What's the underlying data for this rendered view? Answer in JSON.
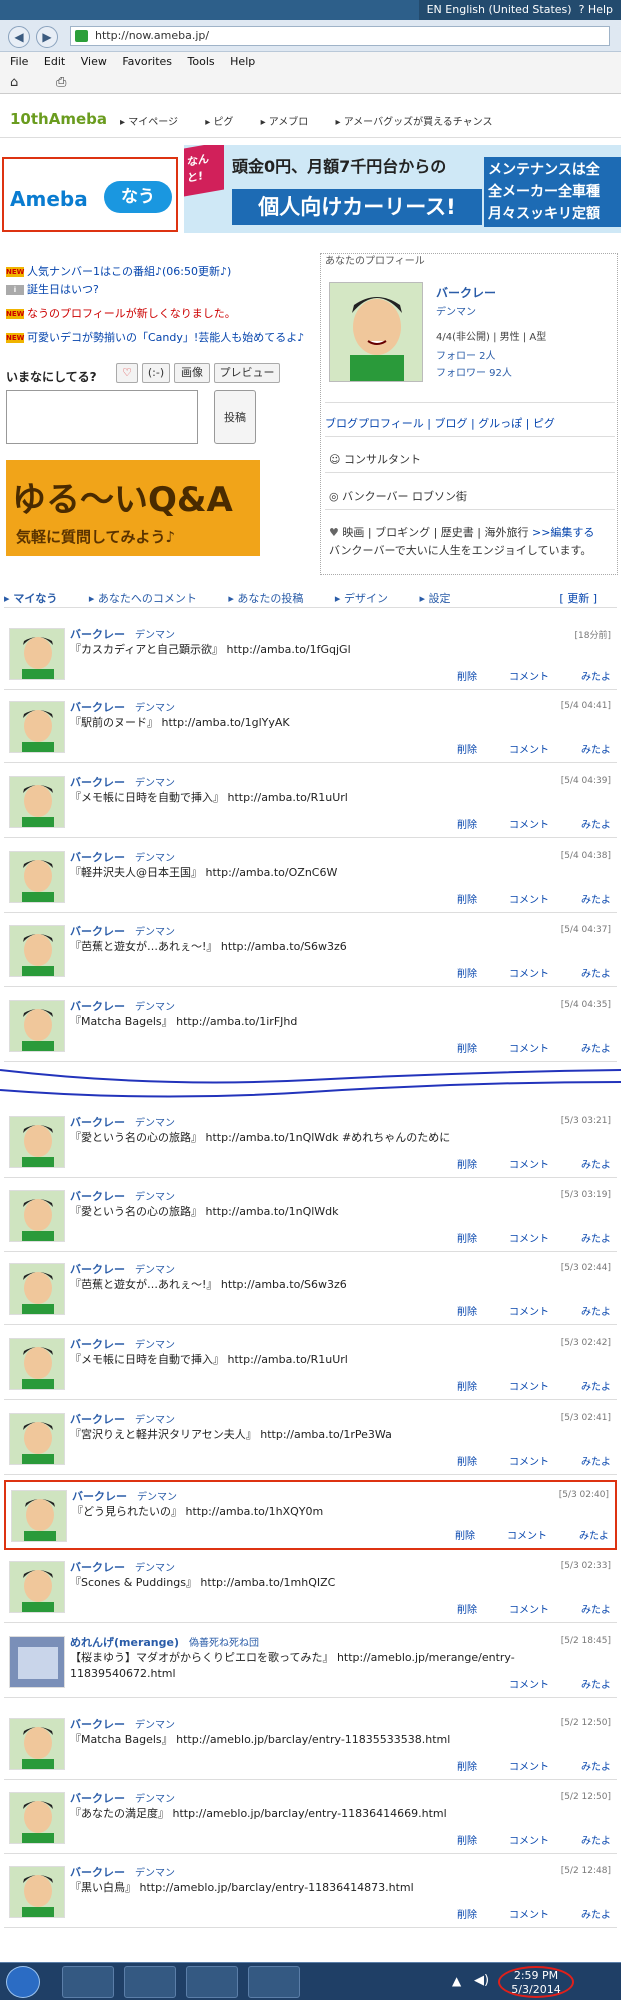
{
  "browser": {
    "language": "EN English (United States)",
    "help": "Help",
    "url": "http://now.ameba.jp/",
    "menu": [
      "File",
      "Edit",
      "View",
      "Favorites",
      "Tools",
      "Help"
    ]
  },
  "header": {
    "logo": "10thAmeba",
    "nav": [
      "マイページ",
      "ピグ",
      "アメブロ",
      "アメーバグッズが買えるチャンス"
    ]
  },
  "brand": {
    "ameba": "Ameba",
    "now": "なう"
  },
  "ad": {
    "tag": "なんと!",
    "line1": "頭金0円、月額7千円台からの",
    "line2": "個人向けカーリース!",
    "side": [
      "メンテナンスは全",
      "全メーカー全車種",
      "月々スッキリ定額"
    ]
  },
  "notices": [
    "人気ナンバー1はこの番組♪(06:50更新♪)",
    "誕生日はいつ?",
    "なうのプロフィールが新しくなりました。",
    "可愛いデコが勢揃いの「Candy」!芸能人も始めてるよ♪"
  ],
  "compose": {
    "label": "いまなにしてる?",
    "buttons": [
      "♡",
      "(:-)",
      "画像",
      "プレビュー"
    ],
    "post": "投稿"
  },
  "qa": {
    "title": "ゆる〜いQ&A",
    "sub": "気軽に質問してみよう♪"
  },
  "profile": {
    "header": "あなたのプロフィール",
    "name": "バークレー",
    "sub": "デンマン",
    "info": "4/4(非公開) | 男性 | A型",
    "follow": "フォロー 2人",
    "followers": "フォロワー 92人",
    "links": "ブログプロフィール | ブログ | グルっぽ | ピグ",
    "job": "コンサルタント",
    "location": "バンクーバー ロブソン街",
    "hobbies": "映画 | ブロギング | 歴史書 | 海外旅行",
    "edit": ">>編集する",
    "bio": "バンクーバーで大いに人生をエンジョイしています。"
  },
  "tabs": [
    "マイなう",
    "あなたへのコメント",
    "あなたの投稿",
    "デザイン",
    "設定"
  ],
  "refresh": "[ 更新 ]",
  "actions": {
    "delete": "削除",
    "comment": "コメント",
    "seen": "みたよ"
  },
  "feed": [
    {
      "name": "バークレー",
      "sub": "デンマン",
      "time": "[18分前]",
      "text": "『カスカディアと自己顕示欲』 http://amba.to/1fGqjGl"
    },
    {
      "name": "バークレー",
      "sub": "デンマン",
      "time": "[5/4 04:41]",
      "text": "『駅前のヌード』 http://amba.to/1glYyAK"
    },
    {
      "name": "バークレー",
      "sub": "デンマン",
      "time": "[5/4 04:39]",
      "text": "『メモ帳に日時を自動で挿入』 http://amba.to/R1uUrl"
    },
    {
      "name": "バークレー",
      "sub": "デンマン",
      "time": "[5/4 04:38]",
      "text": "『軽井沢夫人@日本王国』 http://amba.to/OZnC6W"
    },
    {
      "name": "バークレー",
      "sub": "デンマン",
      "time": "[5/4 04:37]",
      "text": "『芭蕉と遊女が…あれぇ〜!』 http://amba.to/S6w3z6"
    },
    {
      "name": "バークレー",
      "sub": "デンマン",
      "time": "[5/4 04:35]",
      "text": "『Matcha Bagels』 http://amba.to/1irFJhd"
    },
    {
      "name": "バークレー",
      "sub": "デンマン",
      "time": "[5/3 03:21]",
      "text": "『愛という名の心の旅路』 http://amba.to/1nQlWdk #めれちゃんのために"
    },
    {
      "name": "バークレー",
      "sub": "デンマン",
      "time": "[5/3 03:19]",
      "text": "『愛という名の心の旅路』 http://amba.to/1nQlWdk"
    },
    {
      "name": "バークレー",
      "sub": "デンマン",
      "time": "[5/3 02:44]",
      "text": "『芭蕉と遊女が…あれぇ〜!』 http://amba.to/S6w3z6"
    },
    {
      "name": "バークレー",
      "sub": "デンマン",
      "time": "[5/3 02:42]",
      "text": "『メモ帳に日時を自動で挿入』 http://amba.to/R1uUrl"
    },
    {
      "name": "バークレー",
      "sub": "デンマン",
      "time": "[5/3 02:41]",
      "text": "『宮沢りえと軽井沢タリアセン夫人』 http://amba.to/1rPe3Wa"
    },
    {
      "name": "バークレー",
      "sub": "デンマン",
      "time": "[5/3 02:40]",
      "text": "『どう見られたいの』 http://amba.to/1hXQY0m"
    },
    {
      "name": "バークレー",
      "sub": "デンマン",
      "time": "[5/3 02:33]",
      "text": "『Scones & Puddings』 http://amba.to/1mhQIZC"
    },
    {
      "name": "めれんげ(merange)",
      "sub": "偽善死ね死ね団",
      "time": "[5/2 18:45]",
      "text": "【桜まゆう】マダオがからくりピエロを歌ってみた』 http://ameblo.jp/merange/entry-11839540672.html"
    },
    {
      "name": "バークレー",
      "sub": "デンマン",
      "time": "[5/2 12:50]",
      "text": "『Matcha Bagels』 http://ameblo.jp/barclay/entry-11835533538.html"
    },
    {
      "name": "バークレー",
      "sub": "デンマン",
      "time": "[5/2 12:50]",
      "text": "『あなたの満足度』 http://ameblo.jp/barclay/entry-11836414669.html"
    },
    {
      "name": "バークレー",
      "sub": "デンマン",
      "time": "[5/2 12:48]",
      "text": "『黒い白鳥』 http://ameblo.jp/barclay/entry-11836414873.html"
    }
  ],
  "clock": {
    "time": "2:59 PM",
    "date": "5/3/2014"
  },
  "colors": {
    "link": "#0645ad",
    "name": "#2a5ca8",
    "highlight": "#dd3311",
    "accent": "#1a97e0"
  }
}
